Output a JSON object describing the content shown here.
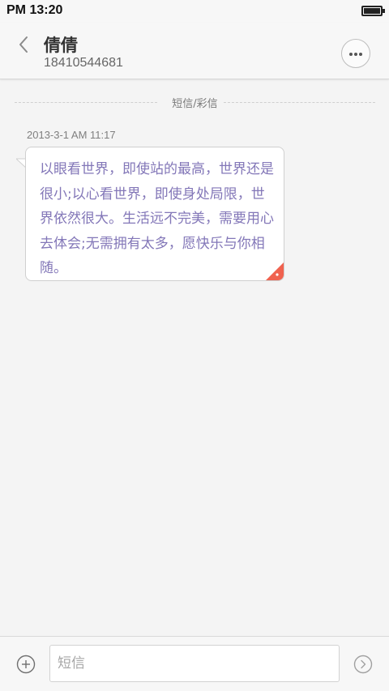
{
  "status_bar": {
    "time": "PM 13:20",
    "battery_icon": "battery-full-icon"
  },
  "header": {
    "back_icon": "chevron-left-icon",
    "contact_name": "倩倩",
    "contact_number": "18410544681",
    "more_icon": "more-horizontal-icon"
  },
  "conversation": {
    "type_label": "短信/彩信",
    "messages": [
      {
        "timestamp": "2013-3-1 AM 11:17",
        "text": "以眼看世界，即使站的最高，世界还是很小;以心看世界，即使身处局限，世界依然很大。生活远不完美，需要用心去体会;无需拥有太多，愿快乐与你相随。",
        "text_color": "#8377b8",
        "corner_flag_color": "#f0624f"
      }
    ]
  },
  "composer": {
    "add_icon": "plus-circle-icon",
    "input_value": "",
    "input_placeholder": "短信",
    "send_icon": "send-circle-icon"
  },
  "colors": {
    "background": "#f4f4f4",
    "message_text": "#8377b8",
    "flag": "#f0624f"
  }
}
